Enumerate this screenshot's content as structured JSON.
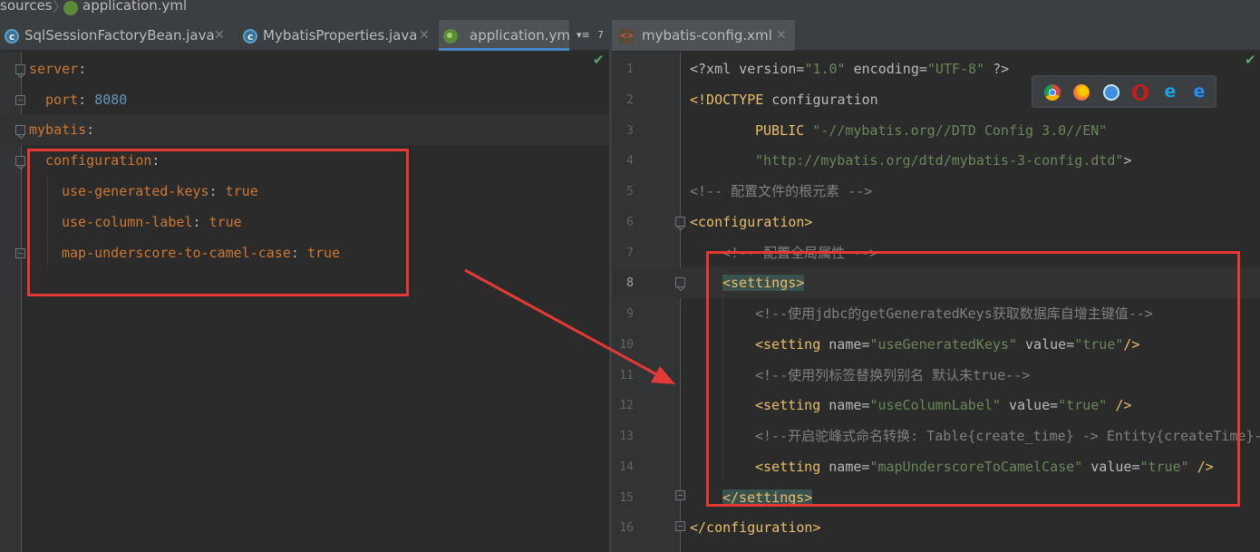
{
  "breadcrumb": {
    "folder": "sources",
    "file": "application.yml"
  },
  "tabs_left": [
    {
      "label": "SqlSessionFactoryBean.java",
      "icon": "java-class-icon",
      "active": false
    },
    {
      "label": "MybatisProperties.java",
      "icon": "java-class-icon",
      "active": false
    },
    {
      "label": "application.yml",
      "icon": "yml-icon",
      "active": true
    }
  ],
  "tab_overflow": {
    "label": "7"
  },
  "tabs_right": [
    {
      "label": "mybatis-config.xml",
      "icon": "xml-icon",
      "active": true
    }
  ],
  "yaml_editor": {
    "lines": [
      {
        "key": "server",
        "colon": ":"
      },
      {
        "key": "port",
        "colon": ": ",
        "value": "8080"
      },
      {
        "key": "mybatis",
        "colon": ":"
      },
      {
        "key": "configuration",
        "colon": ":"
      },
      {
        "key": "use-generated-keys",
        "colon": ": ",
        "value": "true"
      },
      {
        "key": "use-column-label",
        "colon": ": ",
        "value": "true"
      },
      {
        "key": "map-underscore-to-camel-case",
        "colon": ": ",
        "value": "true"
      }
    ]
  },
  "xml_editor": {
    "line_numbers": [
      "1",
      "2",
      "3",
      "4",
      "5",
      "6",
      "7",
      "8",
      "9",
      "10",
      "11",
      "12",
      "13",
      "14",
      "15",
      "16"
    ],
    "line1": {
      "prefix": "<?xml version=",
      "v1": "\"1.0\"",
      "mid": " encoding=",
      "v2": "\"UTF-8\"",
      "suffix": " ?>"
    },
    "line2": {
      "tag": "<!DOCTYPE",
      "text": " configuration"
    },
    "line3": {
      "pub": "PUBLIC ",
      "str": "\"-//mybatis.org//DTD Config 3.0//EN\""
    },
    "line4": {
      "str": "\"http://mybatis.org/dtd/mybatis-3-config.dtd\"",
      "close": ">"
    },
    "line5": {
      "comment": "<!-- 配置文件的根元素 -->"
    },
    "line6": {
      "tag": "<configuration>"
    },
    "line7": {
      "comment": "<!-- 配置全局属性 -->"
    },
    "line8": {
      "tag": "<settings>"
    },
    "line9": {
      "comment": "<!--使用jdbc的getGeneratedKeys获取数据库自增主键值-->"
    },
    "line10": {
      "open": "<setting ",
      "attr1": "name=",
      "val1": "\"useGeneratedKeys\"",
      "attr2": " value=",
      "val2": "\"true\"",
      "close": "/>"
    },
    "line11": {
      "comment": "<!--使用列标签替换列别名 默认未true-->"
    },
    "line12": {
      "open": "<setting ",
      "attr1": "name=",
      "val1": "\"useColumnLabel\"",
      "attr2": " value=",
      "val2": "\"true\"",
      "close": " />"
    },
    "line13": {
      "comment": "<!--开启驼峰式命名转换: Table{create_time} -> Entity{createTime}-->"
    },
    "line14": {
      "open": "<setting ",
      "attr1": "name=",
      "val1": "\"mapUnderscoreToCamelCase\"",
      "attr2": " value=",
      "val2": "\"true\"",
      "close": " />"
    },
    "line15": {
      "tag": "</settings>"
    },
    "line16": {
      "tag": "</configuration>"
    }
  },
  "browser_icons": [
    "chrome-icon",
    "firefox-icon",
    "safari-icon",
    "opera-icon",
    "internet-explorer-icon",
    "edge-icon"
  ],
  "colors": {
    "highlight_box": "#e53935",
    "active_tab_underline": "#4a88c7",
    "check": "#59a869"
  }
}
